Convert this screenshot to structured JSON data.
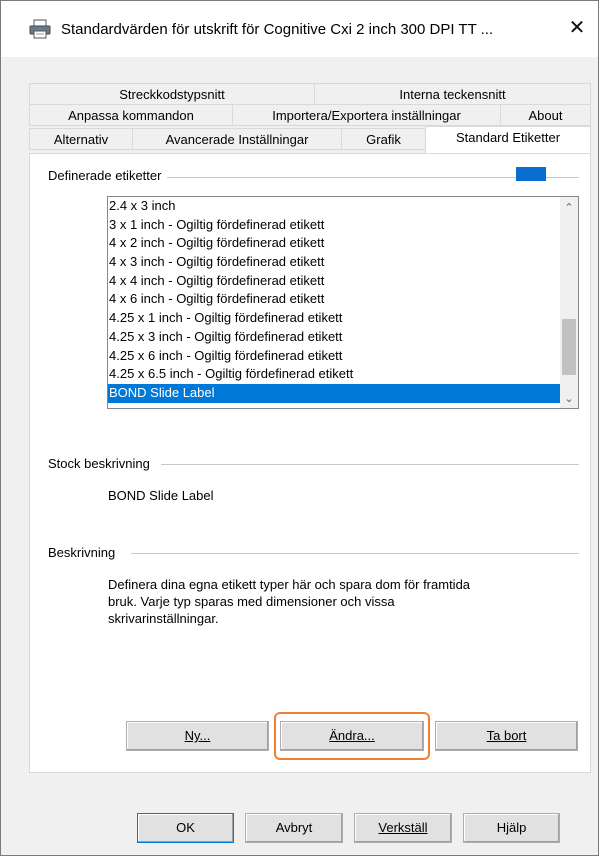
{
  "window": {
    "title": "Standardvärden för utskrift för Cognitive Cxi 2 inch 300 DPI TT ...",
    "close_symbol": "✕"
  },
  "tabs": {
    "row1": [
      "Streckkodstypsnitt",
      "Interna teckensnitt"
    ],
    "row2": [
      "Anpassa kommandon",
      "Importera/Exportera inställningar",
      "About"
    ],
    "row3": [
      "Alternativ",
      "Avancerade Inställningar",
      "Grafik",
      "Standard Etiketter"
    ],
    "active": "Standard Etiketter"
  },
  "defined_labels": {
    "group_label": "Definerade etiketter",
    "items": [
      "2.4 x 3 inch",
      "3 x 1 inch - Ogiltig fördefinerad etikett",
      "4 x 2 inch - Ogiltig fördefinerad etikett",
      "4 x 3 inch - Ogiltig fördefinerad etikett",
      "4 x 4 inch - Ogiltig fördefinerad etikett",
      "4 x 6 inch - Ogiltig fördefinerad etikett",
      "4.25 x 1 inch - Ogiltig fördefinerad etikett",
      "4.25 x 3 inch - Ogiltig fördefinerad etikett",
      "4.25 x 6 inch - Ogiltig fördefinerad etikett",
      "4.25 x 6.5 inch - Ogiltig fördefinerad etikett",
      "BOND Slide Label"
    ],
    "selected": "BOND Slide Label",
    "accent_color": "#0078d7"
  },
  "stock": {
    "group_label": "Stock beskrivning",
    "value": "BOND Slide Label"
  },
  "description": {
    "group_label": "Beskrivning",
    "lines": [
      "Definera dina egna etikett typer här och spara dom för framtida",
      "bruk. Varje typ sparas med dimensioner och vissa",
      "skrivarinställningar."
    ]
  },
  "label_buttons": {
    "new": "Ny...",
    "edit": "Ändra...",
    "delete": "Ta bort"
  },
  "dialog_buttons": {
    "ok": "OK",
    "cancel": "Avbryt",
    "apply": "Verkställ",
    "help": "Hjälp"
  },
  "highlight_color": "#f08030"
}
